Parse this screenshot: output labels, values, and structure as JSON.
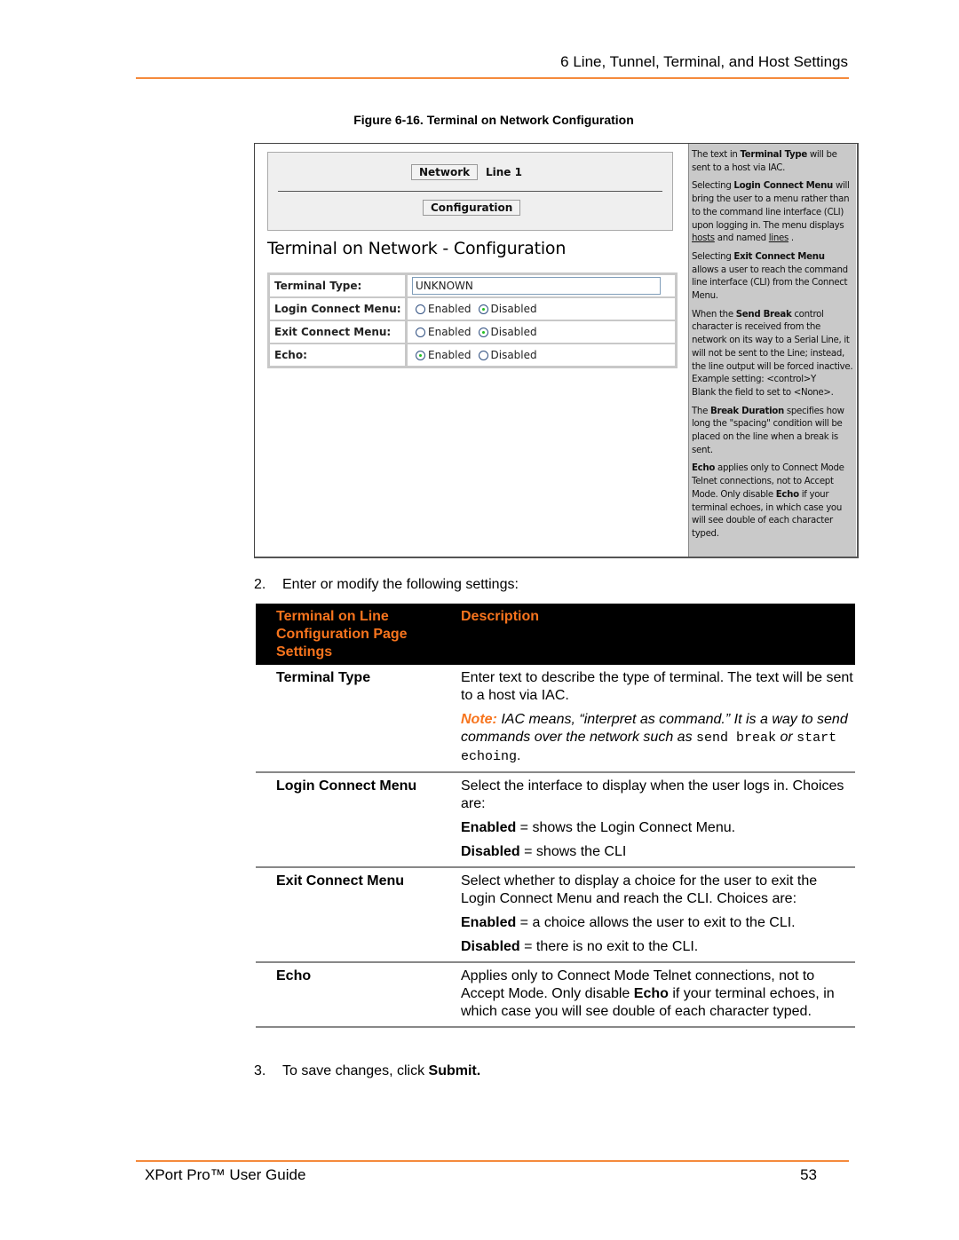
{
  "header": {
    "running_title": "6 Line, Tunnel, Terminal, and Host Settings"
  },
  "figure": {
    "caption": "Figure 6-16. Terminal on Network Configuration",
    "web_ui": {
      "nav": {
        "network_button": "Network",
        "line_link": "Line 1",
        "configuration_button": "Configuration"
      },
      "page_title": "Terminal on Network - Configuration",
      "form": {
        "terminal_type": {
          "label": "Terminal Type:",
          "value": "UNKNOWN"
        },
        "login_connect_menu": {
          "label": "Login Connect Menu:",
          "options": [
            "Enabled",
            "Disabled"
          ],
          "selected": "Disabled"
        },
        "exit_connect_menu": {
          "label": "Exit Connect Menu:",
          "options": [
            "Enabled",
            "Disabled"
          ],
          "selected": "Disabled"
        },
        "echo": {
          "label": "Echo:",
          "options": [
            "Enabled",
            "Disabled"
          ],
          "selected": "Enabled"
        }
      },
      "help": {
        "p1_a": "The text in ",
        "p1_b": "Terminal Type",
        "p1_c": " will be sent to a host via IAC.",
        "p2_a": "Selecting ",
        "p2_b": "Login Connect Menu",
        "p2_c": " will bring the user to a menu rather than to the command line interface (CLI) upon logging in. The menu displays ",
        "p2_link1": "hosts",
        "p2_d": " and named ",
        "p2_link2": "lines",
        "p2_e": " .",
        "p3_a": "Selecting ",
        "p3_b": "Exit Connect Menu",
        "p3_c": " allows a user to reach the command line interface (CLI) from the Connect Menu.",
        "p4_a": "When the ",
        "p4_b": "Send Break",
        "p4_c": " control character is received from the network on its way to a Serial Line, it will not be sent to the Line; instead, the line output will be forced inactive. Example setting: <control>Y",
        "p4_d": "Blank the field to set to <None>.",
        "p5_a": "The ",
        "p5_b": "Break Duration",
        "p5_c": " specifies how long the \"spacing\" condition will be placed on the line when a break is sent.",
        "p6_a": "Echo",
        "p6_b": " applies only to Connect Mode Telnet connections, not to Accept Mode. Only disable ",
        "p6_c": "Echo",
        "p6_d": " if your terminal echoes, in which case you will see double of each character typed."
      }
    }
  },
  "steps": {
    "step2_num": "2.",
    "step2_text": "Enter or modify the following settings:",
    "step3_num": "3.",
    "step3_text": "To save changes, click ",
    "step3_bold": "Submit."
  },
  "settings_table": {
    "headers": [
      "Terminal on Line Configuration Page Settings",
      "Description"
    ],
    "rows": [
      {
        "setting": "Terminal Type",
        "desc": "Enter text to describe the type of terminal. The text will be sent to a host via IAC.",
        "note_label": "Note:",
        "note_text": " IAC means, “interpret as command.” It is a way to send commands over the network such as ",
        "note_code1": "send break",
        "note_or": " or ",
        "note_code2": "start echoing",
        "note_end": "."
      },
      {
        "setting": "Login Connect Menu",
        "desc": "Select the interface to display when the user logs in. Choices are:",
        "opt1_label": "Enabled",
        "opt1_text": " = shows the Login Connect Menu.",
        "opt2_label": "Disabled",
        "opt2_text": " = shows the CLI"
      },
      {
        "setting": "Exit Connect Menu",
        "desc": "Select whether to display a choice for the user to exit the Login Connect Menu and reach the CLI. Choices are:",
        "opt1_label": "Enabled",
        "opt1_text": " = a choice allows the user to exit to the CLI.",
        "opt2_label": "Disabled",
        "opt2_text": " = there is no exit to the CLI."
      },
      {
        "setting": "Echo",
        "desc_a": "Applies only to Connect Mode Telnet connections, not to Accept Mode. Only disable ",
        "desc_b": "Echo",
        "desc_c": " if your terminal echoes, in which case you will see double of each character typed."
      }
    ]
  },
  "footer": {
    "guide_title": "XPort Pro™ User Guide",
    "page_number": "53"
  },
  "colors": {
    "accent_orange": "#f58a3c",
    "header_text_orange": "#f7741d",
    "table_header_bg": "#000000",
    "help_panel_bg": "#c9c9c9"
  }
}
